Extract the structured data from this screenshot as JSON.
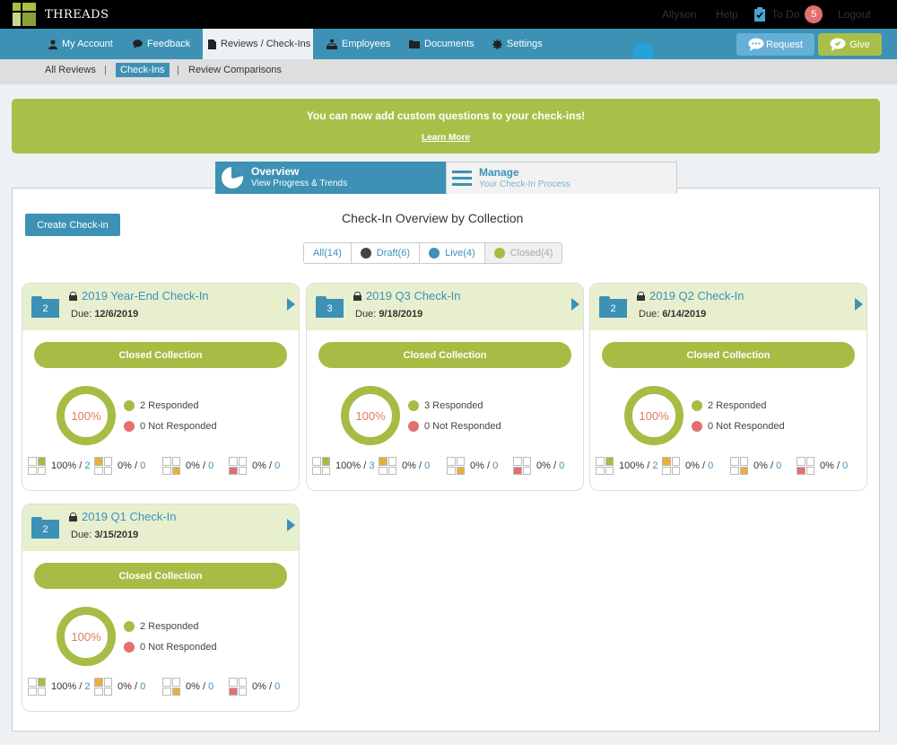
{
  "app": {
    "name": "THREADS"
  },
  "top_links": {
    "user": "Allyson",
    "help": "Help",
    "todo": "To Do",
    "todo_count": "5",
    "logout": "Logout"
  },
  "nav": {
    "items": [
      {
        "label": "My Account",
        "icon": "person-icon"
      },
      {
        "label": "Feedback",
        "icon": "chat-icon"
      },
      {
        "label": "Reviews / Check-Ins",
        "icon": "document-icon"
      },
      {
        "label": "Employees",
        "icon": "org-chart-icon"
      },
      {
        "label": "Documents",
        "icon": "folder-icon"
      },
      {
        "label": "Settings",
        "icon": "gear-icon"
      }
    ],
    "request": "Request",
    "give": "Give"
  },
  "subnav": {
    "all_reviews": "All Reviews",
    "check_ins": "Check-Ins",
    "comparisons": "Review Comparisons",
    "sep": "|"
  },
  "banner": {
    "message": "You can now add custom questions to your check-ins!",
    "link": "Learn More"
  },
  "tabs": {
    "overview": {
      "title": "Overview",
      "subtitle": "View Progress & Trends"
    },
    "manage": {
      "title": "Manage",
      "subtitle": "Your Check-In Process"
    }
  },
  "main": {
    "create_button": "Create Check-in",
    "title": "Check-In Overview by Collection",
    "filters": [
      {
        "label": "All(14)"
      },
      {
        "label": "Draft(6)",
        "color": "#444444"
      },
      {
        "label": "Live(4)",
        "color": "#3d91b5"
      },
      {
        "label": "Closed(4)",
        "color": "#a8bb44"
      }
    ]
  },
  "colors": {
    "accent": "#3d91b5",
    "green": "#a8bb44",
    "red": "#e36f6f"
  },
  "cards": [
    {
      "count": "2",
      "title": "2019 Year-End Check-In",
      "due_label": "Due:",
      "due": "12/6/2019",
      "status": "Closed Collection",
      "percent": "100%",
      "responded": "2 Responded",
      "not_responded": "0 Not Responded",
      "stats": [
        {
          "pct": "100%",
          "sep": "/",
          "n": "2"
        },
        {
          "pct": "0%",
          "sep": "/",
          "n": "0"
        },
        {
          "pct": "0%",
          "sep": "/",
          "n": "0"
        },
        {
          "pct": "0%",
          "sep": "/",
          "n": "0"
        }
      ]
    },
    {
      "count": "3",
      "title": "2019 Q3 Check-In",
      "due_label": "Due:",
      "due": "9/18/2019",
      "status": "Closed Collection",
      "percent": "100%",
      "responded": "3 Responded",
      "not_responded": "0 Not Responded",
      "stats": [
        {
          "pct": "100%",
          "sep": "/",
          "n": "3"
        },
        {
          "pct": "0%",
          "sep": "/",
          "n": "0"
        },
        {
          "pct": "0%",
          "sep": "/",
          "n": "0"
        },
        {
          "pct": "0%",
          "sep": "/",
          "n": "0"
        }
      ]
    },
    {
      "count": "2",
      "title": "2019 Q2 Check-In",
      "due_label": "Due:",
      "due": "6/14/2019",
      "status": "Closed Collection",
      "percent": "100%",
      "responded": "2 Responded",
      "not_responded": "0 Not Responded",
      "stats": [
        {
          "pct": "100%",
          "sep": "/",
          "n": "2"
        },
        {
          "pct": "0%",
          "sep": "/",
          "n": "0"
        },
        {
          "pct": "0%",
          "sep": "/",
          "n": "0"
        },
        {
          "pct": "0%",
          "sep": "/",
          "n": "0"
        }
      ]
    },
    {
      "count": "2",
      "title": "2019 Q1 Check-In",
      "due_label": "Due:",
      "due": "3/15/2019",
      "status": "Closed Collection",
      "percent": "100%",
      "responded": "2 Responded",
      "not_responded": "0 Not Responded",
      "stats": [
        {
          "pct": "100%",
          "sep": "/",
          "n": "2"
        },
        {
          "pct": "0%",
          "sep": "/",
          "n": "0"
        },
        {
          "pct": "0%",
          "sep": "/",
          "n": "0"
        },
        {
          "pct": "0%",
          "sep": "/",
          "n": "0"
        }
      ]
    }
  ]
}
